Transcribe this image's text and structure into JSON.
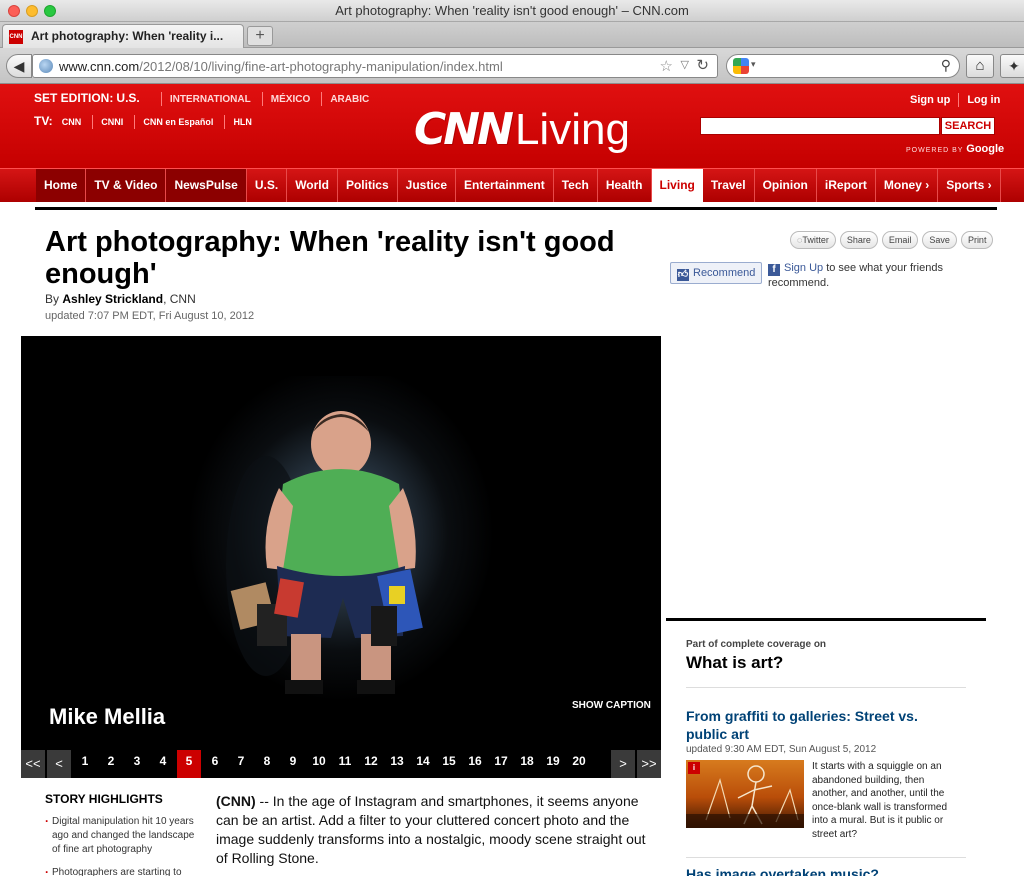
{
  "window": {
    "title": "Art photography: When 'reality isn't good enough' – CNN.com"
  },
  "tab": {
    "title": "Art photography: When 'reality i...",
    "favicon": "CNN",
    "new_tab_label": "+"
  },
  "toolbar": {
    "url_host": "www.cnn.com",
    "url_path": "/2012/08/10/living/fine-art-photography-manipulation/index.html"
  },
  "header": {
    "edition_label": "SET EDITION:",
    "edition_current": "U.S.",
    "editions": [
      "INTERNATIONAL",
      "MÉXICO",
      "ARABIC"
    ],
    "tv_label": "TV:",
    "tv_links": [
      "CNN",
      "CNNI",
      "CNN en Español",
      "HLN"
    ],
    "logo_brand": "CNN",
    "logo_section": "Living",
    "sign_up": "Sign up",
    "log_in": "Log in",
    "search_button": "SEARCH",
    "powered_by": "POWERED BY",
    "powered_google": "Google"
  },
  "nav": {
    "items": [
      "Home",
      "TV & Video",
      "NewsPulse",
      "U.S.",
      "World",
      "Politics",
      "Justice",
      "Entertainment",
      "Tech",
      "Health",
      "Living",
      "Travel",
      "Opinion",
      "iReport",
      "Money ›",
      "Sports ›"
    ],
    "active": "Living"
  },
  "article": {
    "headline": "Art photography: When 'reality isn't good enough'",
    "by_prefix": "By",
    "author": "Ashley Strickland",
    "outlet": ", CNN",
    "updated": "updated 7:07 PM EDT, Fri August 10, 2012",
    "share": [
      "Twitter",
      "Share",
      "Email",
      "Save",
      "Print"
    ],
    "recommend": "Recommend",
    "fb_signup": "Sign Up",
    "fb_text": " to see what your friends recommend."
  },
  "gallery": {
    "caption": "Mike Mellia",
    "show_caption": "SHOW CAPTION",
    "prev_all": "<<",
    "prev": "<",
    "next": ">",
    "next_all": ">>",
    "pages": [
      "1",
      "2",
      "3",
      "4",
      "5",
      "6",
      "7",
      "8",
      "9",
      "10",
      "11",
      "12",
      "13",
      "14",
      "15",
      "16",
      "17",
      "18",
      "19",
      "20"
    ],
    "current_page": "5"
  },
  "highlights": {
    "title": "STORY HIGHLIGHTS",
    "items": [
      "Digital manipulation hit 10 years ago and changed the landscape of fine art photography",
      "Photographers are starting to"
    ]
  },
  "body": {
    "dateline": "(CNN)",
    "text": " -- In the age of Instagram and smartphones, it seems anyone can be an artist. Add a filter to your cluttered concert photo and the image suddenly transforms into a nostalgic, moody scene straight out of Rolling Stone."
  },
  "sidebar": {
    "coverage_label": "Part of complete coverage on",
    "coverage_title": "What is art?",
    "story_title": "From graffiti to galleries: Street vs. public art",
    "story_date": "updated 9:30 AM EDT, Sun August 5, 2012",
    "story_text": "It starts with a squiggle on an abandoned building, then another, and another, until the once-blank wall is transformed into a mural. But is it public or street art?",
    "next_story": "Has image overtaken music?"
  },
  "colors": {
    "cnn_red": "#cc0000",
    "link_blue": "#004276",
    "facebook_blue": "#3b5998"
  }
}
